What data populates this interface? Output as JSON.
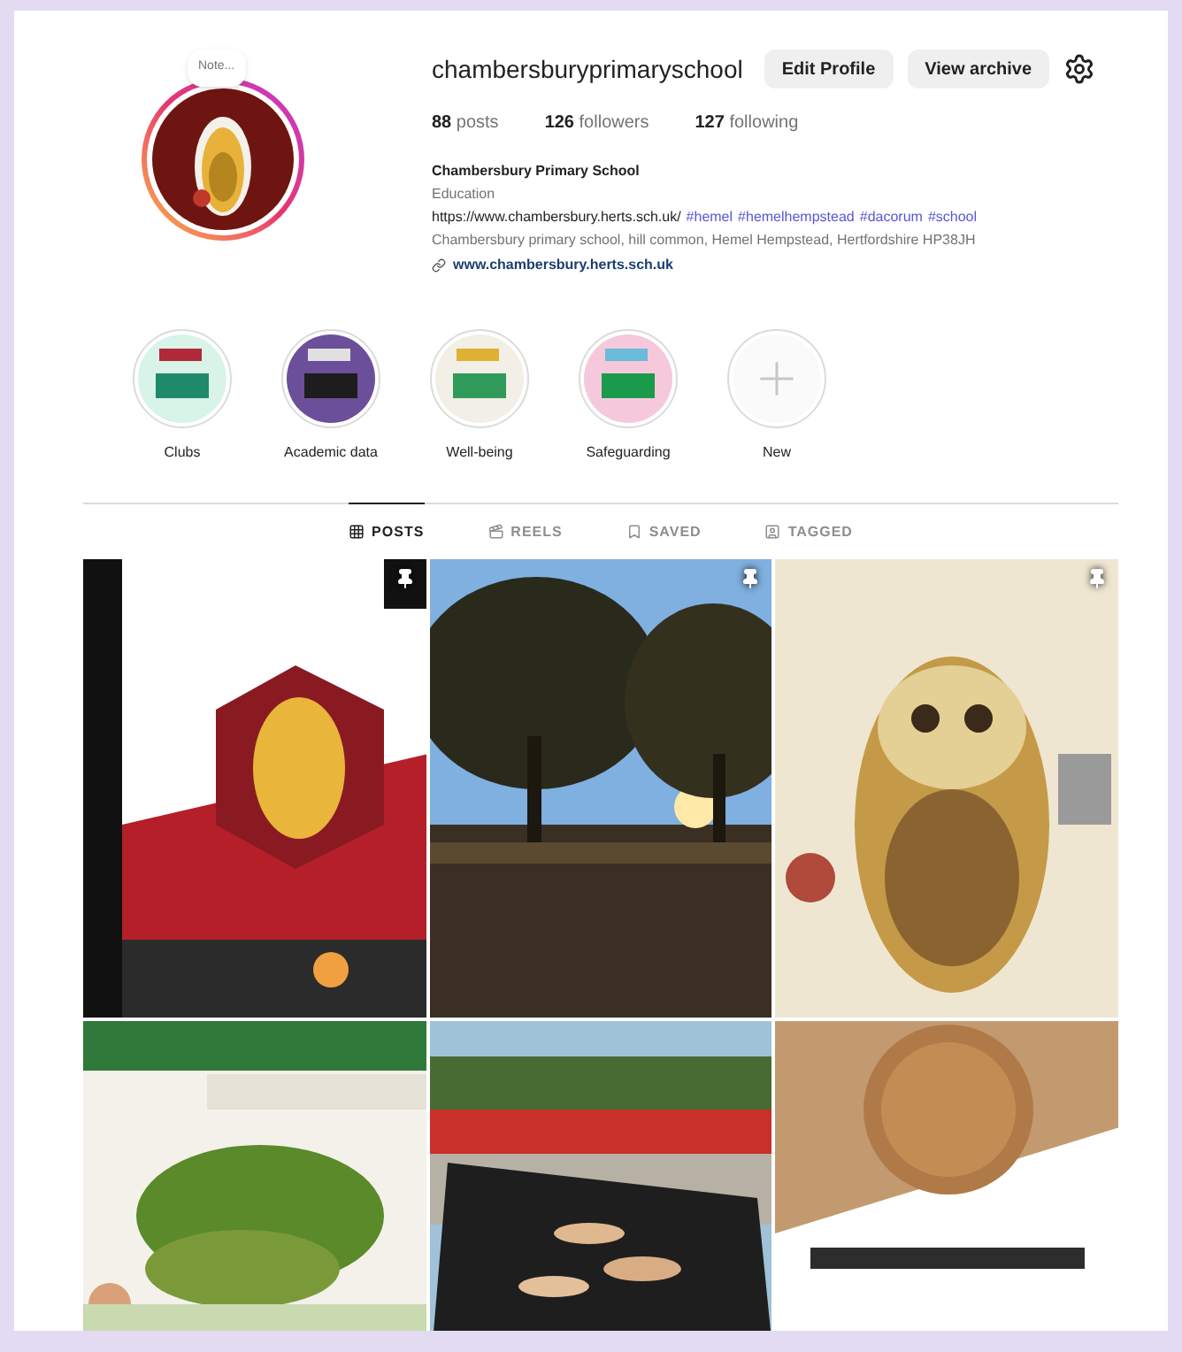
{
  "profile": {
    "note": "Note...",
    "username": "chambersburyprimaryschool",
    "buttons": [
      "Edit Profile",
      "View archive"
    ],
    "stats": [
      {
        "count": "88",
        "label": "posts"
      },
      {
        "count": "126",
        "label": "followers"
      },
      {
        "count": "127",
        "label": "following"
      }
    ],
    "name": "Chambersbury Primary School",
    "category": "Education",
    "bio_url": "https://www.chambersbury.herts.sch.uk/",
    "hashtags": [
      "#hemel",
      "#hemelhempstead",
      "#dacorum",
      "#school"
    ],
    "address": "Chambersbury primary school, hill common, Hemel Hempstead, Hertfordshire HP38JH",
    "link": "www.chambersbury.herts.sch.uk"
  },
  "highlights": [
    {
      "label": "Clubs",
      "kind": "picture"
    },
    {
      "label": "Academic data",
      "kind": "picture"
    },
    {
      "label": "Well-being",
      "kind": "picture"
    },
    {
      "label": "Safeguarding",
      "kind": "picture"
    },
    {
      "label": "New",
      "kind": "new"
    }
  ],
  "tabs": [
    {
      "label": "POSTS",
      "selected": true
    },
    {
      "label": "REELS",
      "selected": false
    },
    {
      "label": "SAVED",
      "selected": false
    },
    {
      "label": "TAGGED",
      "selected": false
    }
  ],
  "posts": [
    {
      "kind": "picture",
      "pinned": true
    },
    {
      "kind": "picture",
      "pinned": true
    },
    {
      "kind": "picture",
      "pinned": true
    },
    {
      "kind": "picture",
      "pinned": false
    },
    {
      "kind": "picture",
      "pinned": false
    },
    {
      "kind": "picture",
      "pinned": false
    }
  ]
}
